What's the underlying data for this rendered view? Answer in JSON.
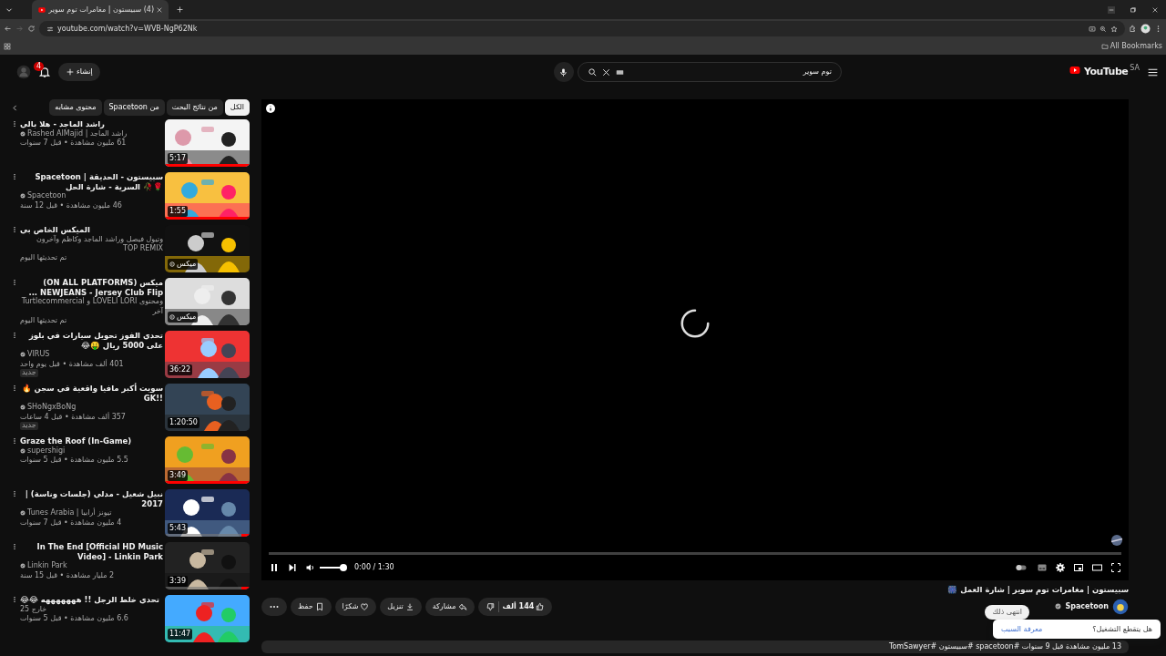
{
  "browser": {
    "tab_title": "(4) سبيستون | مغامرات توم سوير",
    "url": "youtube.com/watch?v=WVB-NgP62Nk",
    "bookmarks_label": "All Bookmarks"
  },
  "header": {
    "notification_count": "4",
    "create_label": "إنشاء",
    "search_value": "توم سوير",
    "logo": "YouTube",
    "country": "SA"
  },
  "chips": [
    {
      "label": "الكل",
      "selected": true
    },
    {
      "label": "من نتائج البحث",
      "selected": false
    },
    {
      "label": "من Spacetoon",
      "selected": false
    },
    {
      "label": "محتوى مشابه",
      "selected": false
    }
  ],
  "videos": [
    {
      "kind": "video",
      "title": "راشد الماجد - هلا بالي",
      "channel": "راشد الماجد | Rashed AlMajid",
      "verified": true,
      "meta": "61 مليون مشاهدة • قبل 7 سنوات",
      "duration": "5:17",
      "level": 1
    },
    {
      "kind": "video",
      "title": "Spacetoon | سبيستون - الحديقة السرية - شارة الحل 🥀🌹",
      "channel": "Spacetoon",
      "verified": true,
      "meta": "46 مليون مشاهدة • قبل 12 سنة",
      "duration": "1:55",
      "level": 1
    },
    {
      "kind": "mix",
      "title": "الميكس الخاص بي",
      "channel": "وتيول فيصل وراشد الماجد وكاظم وآخرون TOP REMIX",
      "verified": false,
      "meta": "تم تحديثها اليوم",
      "duration": "ميكس"
    },
    {
      "kind": "mix",
      "title": "ميكس (ON ALL PLATFORMS) NEWJEANS - Jersey Club Flip ...",
      "channel": "Turtlecommercial و LOVELI LORI ومحتوى آخر",
      "verified": false,
      "meta": "تم تحديثها اليوم",
      "duration": "ميكس"
    },
    {
      "kind": "video",
      "title": "تحدي الفوز تحويل سيارات في بلوز على 5000 ريال 🤑😂",
      "channel": "VIRUS",
      "verified": true,
      "meta": "401 ألف مشاهدة • قبل يوم واحد",
      "duration": "36:22",
      "badge": "جديد"
    },
    {
      "kind": "video",
      "title": "سويت أكبر مافيا واقعية في سجن 🔥 !!GK",
      "channel": "SHoNgxBoNg",
      "verified": true,
      "meta": "357 ألف مشاهدة • قبل 4 ساعات",
      "duration": "1:20:50",
      "badge": "جديد"
    },
    {
      "kind": "video",
      "title": "Graze the Roof (In-Game)",
      "channel": "supershigi",
      "verified": true,
      "meta": "5.5 مليون مشاهدة • قبل 5 سنوات",
      "duration": "3:49",
      "level": 1
    },
    {
      "kind": "video",
      "title": "نبيل شعيل - مدلي (جلسات وناسة) | 2017",
      "channel": "تيونز أرابيا | Tunes Arabia",
      "verified": true,
      "meta": "4 مليون مشاهدة • قبل 7 سنوات",
      "duration": "5:43",
      "level": 0.1
    },
    {
      "kind": "video",
      "title": "In The End [Official HD Music Video] - Linkin Park",
      "channel": "Linkin Park",
      "verified": true,
      "meta": "2 مليار مشاهدة • قبل 15 سنة",
      "duration": "3:39",
      "level": 0.1
    },
    {
      "kind": "video",
      "title": "تحدي خلط الرجل !! هههههههه 😂😂",
      "channel": "خارج 25",
      "verified": false,
      "meta": "6.6 مليون مشاهدة • قبل 5 سنوات",
      "duration": "11:47"
    }
  ],
  "player": {
    "time": "0:00 / 1:30",
    "progress": {
      "level": 0
    },
    "volume": {
      "level": 1
    },
    "autoplay": false
  },
  "video": {
    "title": "سبيستون | مغامرات توم سوير | شارة العمل 🎆",
    "channel": "Spacetoon",
    "channel_verified": true,
    "likes": "144 ألف",
    "actions": [
      {
        "kind": "share",
        "label": "مشاركة"
      },
      {
        "kind": "download",
        "label": "تنزيل"
      },
      {
        "kind": "thanks",
        "label": "شكرًا"
      },
      {
        "kind": "save",
        "label": "حفظ"
      }
    ],
    "description": "13 مليون مشاهدة قبل 9 سنوات #spacetoon #سبيستون #TomSawyer"
  },
  "popup": {
    "question": "هل يتقطع التشغيل؟",
    "link": "معرفة السبب",
    "tooltip": "انتهى ذلك"
  }
}
